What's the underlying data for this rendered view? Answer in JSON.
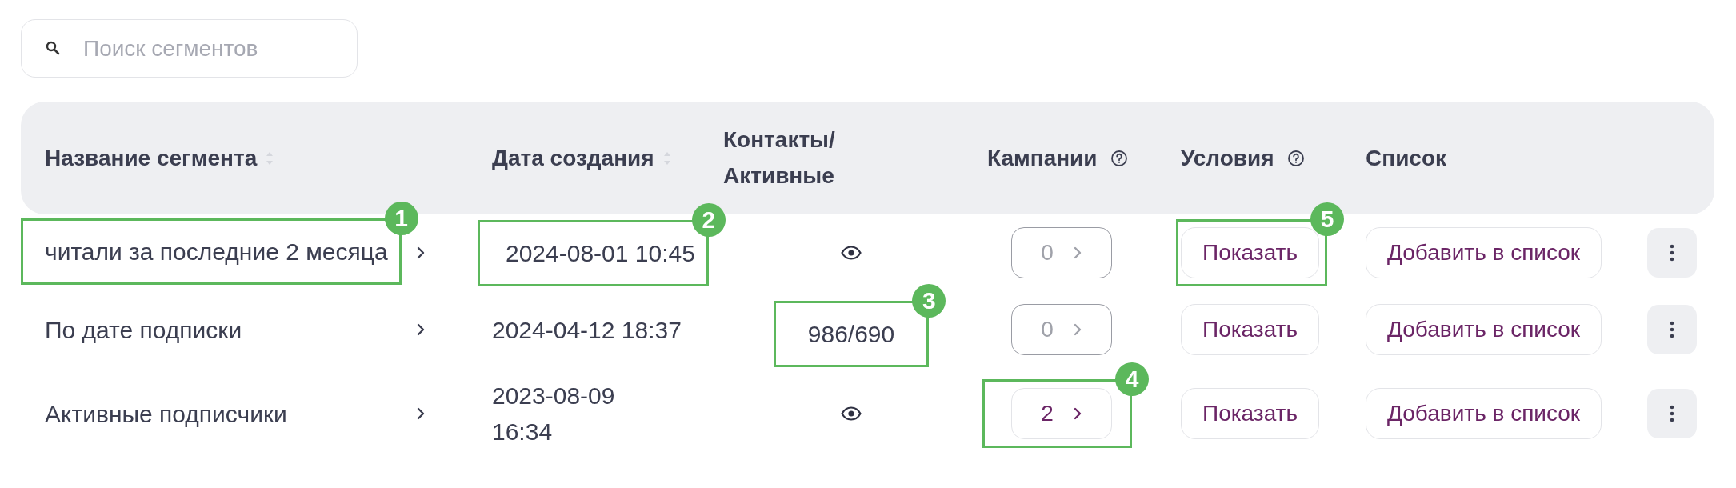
{
  "search": {
    "placeholder": "Поиск сегментов"
  },
  "table": {
    "columns": [
      {
        "kind": "name",
        "label": "Название сегмента",
        "sortable": true,
        "help": false
      },
      {
        "kind": "date",
        "label": "Дата создания",
        "sortable": true,
        "help": false
      },
      {
        "kind": "contacts",
        "label": "Контакты/ Активные",
        "sortable": false,
        "help": false
      },
      {
        "kind": "campaigns",
        "label": "Кампании",
        "sortable": false,
        "help": true
      },
      {
        "kind": "conditions",
        "label": "Условия",
        "sortable": false,
        "help": true
      },
      {
        "kind": "list",
        "label": "Список",
        "sortable": false,
        "help": false
      }
    ],
    "rows": [
      {
        "name": "читали за последние 2 месяца",
        "date": "2024-08-01 10:45",
        "date_wrapped": false,
        "contacts": {
          "kind": "hidden"
        },
        "campaigns": {
          "count": "0",
          "disabled": true
        },
        "conditions_button": "Показать",
        "list_button": "Добавить в список",
        "callouts": {
          "name": "1",
          "date": "2",
          "conditions": "5"
        }
      },
      {
        "name": "По дате подписки",
        "date": "2024-04-12 18:37",
        "date_wrapped": false,
        "contacts": {
          "kind": "value",
          "text": "986/690"
        },
        "campaigns": {
          "count": "0",
          "disabled": true
        },
        "conditions_button": "Показать",
        "list_button": "Добавить в список",
        "callouts": {
          "contacts": "3"
        }
      },
      {
        "name": "Активные подписчики",
        "date": "2023-08-09 16:34",
        "date_wrapped": true,
        "contacts": {
          "kind": "hidden"
        },
        "campaigns": {
          "count": "2",
          "disabled": false
        },
        "conditions_button": "Показать",
        "list_button": "Добавить в список",
        "callouts": {
          "campaigns": "4"
        }
      }
    ]
  }
}
